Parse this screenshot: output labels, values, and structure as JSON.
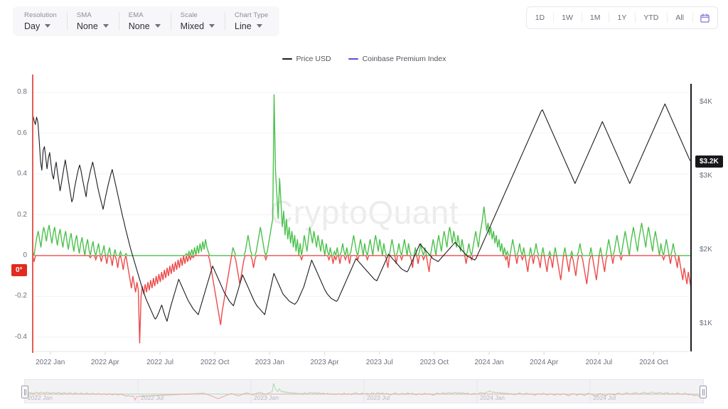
{
  "toolbar": {
    "groups": [
      {
        "label": "Resolution",
        "value": "Day",
        "name": "resolution"
      },
      {
        "label": "SMA",
        "value": "None",
        "name": "sma"
      },
      {
        "label": "EMA",
        "value": "None",
        "name": "ema"
      },
      {
        "label": "Scale",
        "value": "Mixed",
        "name": "scale"
      },
      {
        "label": "Chart Type",
        "value": "Line",
        "name": "chart-type"
      }
    ]
  },
  "range_bar": {
    "buttons": [
      "1D",
      "1W",
      "1M",
      "1Y",
      "YTD",
      "All"
    ],
    "calendar_icon": "calendar-icon",
    "accent": "#7b61d9"
  },
  "watermark": "CryptoQuant",
  "badges": {
    "price": "$3.2K",
    "zero": "0°"
  },
  "chart_data": {
    "type": "line",
    "title": "",
    "xlabel": "",
    "legend": [
      {
        "label": "Price USD",
        "color": "#1d1d22"
      },
      {
        "label": "Coinbase Premium Index",
        "color": "#5b4fd6"
      }
    ],
    "legend_position": "top-center",
    "grid": true,
    "x_ticks": [
      "2022 Jan",
      "2022 Apr",
      "2022 Jul",
      "2022 Oct",
      "2023 Jan",
      "2023 Apr",
      "2023 Jul",
      "2023 Oct",
      "2024 Jan",
      "2024 Apr",
      "2024 Jul",
      "2024 Oct"
    ],
    "left_axis": {
      "name": "Coinbase Premium Index",
      "ticks": [
        0.8,
        0.6,
        0.4,
        0.2,
        0,
        -0.2,
        -0.4
      ],
      "tick_labels": [
        "0.8",
        "0.6",
        "0.4",
        "0.2",
        "0",
        "-0.2",
        "-0.4"
      ],
      "ylim": [
        -0.47,
        0.87
      ],
      "zero_line": 0,
      "positive_color": "#4cc14c",
      "negative_color": "#ec4a4a"
    },
    "right_axis": {
      "name": "Price USD",
      "ticks": [
        4000,
        3000,
        2000,
        1000
      ],
      "tick_labels": [
        "$4K",
        "$3K",
        "$2K",
        "$1K"
      ],
      "ylim": [
        620,
        4330
      ],
      "color": "#1d1d22"
    },
    "series": [
      {
        "name": "Price USD",
        "axis": "right",
        "color": "#1d1d22",
        "values": [
          3840,
          3760,
          3700,
          3800,
          3730,
          3480,
          3200,
          3080,
          3350,
          3400,
          3250,
          3100,
          3240,
          3320,
          3170,
          3020,
          2960,
          3100,
          3190,
          3050,
          2930,
          2800,
          2900,
          3010,
          3120,
          3220,
          3100,
          2990,
          2870,
          2760,
          2650,
          2700,
          2830,
          2920,
          3010,
          3090,
          3150,
          3080,
          2980,
          2890,
          2800,
          2720,
          2880,
          2960,
          3050,
          3120,
          3190,
          3110,
          3020,
          2930,
          2840,
          2760,
          2690,
          2620,
          2550,
          2640,
          2730,
          2810,
          2890,
          2960,
          3030,
          3090,
          3010,
          2930,
          2850,
          2770,
          2690,
          2610,
          2530,
          2450,
          2380,
          2300,
          2230,
          2160,
          2090,
          2020,
          1960,
          1900,
          1840,
          1780,
          1720,
          1660,
          1600,
          1540,
          1480,
          1430,
          1380,
          1330,
          1290,
          1250,
          1210,
          1170,
          1130,
          1090,
          1060,
          1080,
          1120,
          1160,
          1210,
          1250,
          1190,
          1130,
          1080,
          1030,
          1100,
          1170,
          1240,
          1300,
          1360,
          1420,
          1480,
          1540,
          1600,
          1560,
          1520,
          1480,
          1440,
          1400,
          1360,
          1320,
          1290,
          1260,
          1230,
          1200,
          1180,
          1160,
          1140,
          1120,
          1180,
          1240,
          1300,
          1360,
          1420,
          1480,
          1540,
          1600,
          1660,
          1720,
          1780,
          1740,
          1700,
          1660,
          1620,
          1580,
          1540,
          1500,
          1460,
          1420,
          1390,
          1360,
          1330,
          1300,
          1280,
          1260,
          1240,
          1300,
          1360,
          1420,
          1480,
          1540,
          1600,
          1660,
          1620,
          1580,
          1540,
          1500,
          1460,
          1420,
          1380,
          1340,
          1300,
          1270,
          1240,
          1220,
          1200,
          1180,
          1160,
          1140,
          1120,
          1200,
          1280,
          1360,
          1440,
          1520,
          1600,
          1680,
          1640,
          1600,
          1560,
          1520,
          1480,
          1440,
          1400,
          1380,
          1360,
          1340,
          1320,
          1300,
          1290,
          1280,
          1270,
          1260,
          1280,
          1300,
          1340,
          1380,
          1420,
          1460,
          1500,
          1560,
          1620,
          1680,
          1740,
          1800,
          1860,
          1820,
          1780,
          1740,
          1700,
          1660,
          1620,
          1580,
          1540,
          1500,
          1460,
          1430,
          1400,
          1380,
          1360,
          1340,
          1330,
          1320,
          1310,
          1300,
          1320,
          1360,
          1400,
          1440,
          1480,
          1520,
          1560,
          1600,
          1640,
          1680,
          1720,
          1760,
          1800,
          1840,
          1880,
          1860,
          1840,
          1820,
          1800,
          1780,
          1760,
          1740,
          1720,
          1700,
          1680,
          1660,
          1640,
          1620,
          1600,
          1590,
          1580,
          1620,
          1660,
          1700,
          1740,
          1780,
          1820,
          1860,
          1900,
          1940,
          1920,
          1900,
          1880,
          1860,
          1840,
          1820,
          1800,
          1780,
          1760,
          1740,
          1730,
          1720,
          1710,
          1700,
          1720,
          1760,
          1800,
          1840,
          1880,
          1920,
          1960,
          2000,
          2040,
          2080,
          2060,
          2040,
          2020,
          2000,
          1980,
          1960,
          1940,
          1920,
          1900,
          1880,
          1870,
          1860,
          1850,
          1840,
          1860,
          1880,
          1900,
          1920,
          1940,
          1960,
          1980,
          2000,
          2020,
          2040,
          2060,
          2080,
          2100,
          2080,
          2060,
          2040,
          2020,
          2000,
          1980,
          1960,
          1940,
          1920,
          1910,
          1900,
          1890,
          1880,
          1870,
          1860,
          1880,
          1920,
          1960,
          2000,
          2040,
          2080,
          2120,
          2160,
          2200,
          2240,
          2280,
          2320,
          2360,
          2400,
          2440,
          2480,
          2520,
          2560,
          2600,
          2640,
          2680,
          2720,
          2760,
          2800,
          2840,
          2880,
          2920,
          2960,
          3000,
          3040,
          3080,
          3120,
          3160,
          3200,
          3240,
          3280,
          3320,
          3360,
          3400,
          3440,
          3480,
          3520,
          3560,
          3600,
          3640,
          3680,
          3720,
          3760,
          3800,
          3840,
          3880,
          3900,
          3860,
          3820,
          3780,
          3740,
          3700,
          3660,
          3620,
          3580,
          3540,
          3500,
          3460,
          3420,
          3380,
          3340,
          3300,
          3260,
          3220,
          3180,
          3140,
          3100,
          3060,
          3020,
          2980,
          2940,
          2900,
          2940,
          2980,
          3020,
          3060,
          3100,
          3140,
          3180,
          3220,
          3260,
          3300,
          3340,
          3380,
          3420,
          3460,
          3500,
          3540,
          3580,
          3620,
          3660,
          3700,
          3740,
          3700,
          3660,
          3620,
          3580,
          3540,
          3500,
          3460,
          3420,
          3380,
          3340,
          3300,
          3260,
          3220,
          3180,
          3140,
          3100,
          3060,
          3020,
          2980,
          2940,
          2900,
          2940,
          2980,
          3020,
          3060,
          3100,
          3140,
          3180,
          3220,
          3260,
          3300,
          3340,
          3380,
          3420,
          3460,
          3500,
          3540,
          3580,
          3620,
          3660,
          3700,
          3740,
          3780,
          3820,
          3860,
          3900,
          3940,
          3980,
          3940,
          3900,
          3860,
          3820,
          3780,
          3740,
          3700,
          3660,
          3620,
          3580,
          3540,
          3500,
          3460,
          3420,
          3380,
          3340,
          3300,
          3260,
          3220,
          3200
        ],
        "last_value": 3200
      },
      {
        "name": "Coinbase Premium Index",
        "axis": "left",
        "color_positive": "#4cc14c",
        "color_negative": "#ec4a4a",
        "values": [
          0.02,
          -0.03,
          0.05,
          0.09,
          0.12,
          0.08,
          0.04,
          0.1,
          0.14,
          0.11,
          0.07,
          0.12,
          0.15,
          0.1,
          0.06,
          0.11,
          0.14,
          0.09,
          0.05,
          0.1,
          0.13,
          0.08,
          0.04,
          0.09,
          0.12,
          0.07,
          0.03,
          0.08,
          0.11,
          0.06,
          0.02,
          0.07,
          0.1,
          0.05,
          0.01,
          0.06,
          0.09,
          0.04,
          0.0,
          0.05,
          0.08,
          0.03,
          -0.01,
          0.04,
          0.07,
          0.02,
          -0.02,
          0.03,
          0.06,
          0.01,
          -0.03,
          0.02,
          0.05,
          0.0,
          -0.04,
          0.01,
          0.04,
          -0.01,
          -0.05,
          0.0,
          0.03,
          -0.02,
          -0.06,
          -0.01,
          0.02,
          -0.03,
          -0.07,
          -0.02,
          0.01,
          -0.04,
          -0.08,
          -0.12,
          -0.16,
          -0.1,
          -0.14,
          -0.18,
          -0.13,
          -0.17,
          -0.43,
          -0.2,
          -0.15,
          -0.19,
          -0.14,
          -0.18,
          -0.13,
          -0.17,
          -0.12,
          -0.16,
          -0.11,
          -0.15,
          -0.1,
          -0.14,
          -0.09,
          -0.13,
          -0.08,
          -0.12,
          -0.07,
          -0.11,
          -0.06,
          -0.1,
          -0.05,
          -0.09,
          -0.04,
          -0.08,
          -0.03,
          -0.07,
          -0.02,
          -0.06,
          -0.01,
          -0.05,
          0.0,
          -0.04,
          0.01,
          -0.03,
          0.02,
          -0.02,
          0.03,
          -0.01,
          0.04,
          0.0,
          0.05,
          0.01,
          0.06,
          0.02,
          0.07,
          0.03,
          0.08,
          0.04,
          0.02,
          -0.02,
          -0.06,
          -0.1,
          -0.14,
          -0.18,
          -0.22,
          -0.26,
          -0.3,
          -0.34,
          -0.28,
          -0.24,
          -0.2,
          -0.16,
          -0.12,
          -0.08,
          -0.04,
          0.0,
          0.04,
          0.02,
          -0.02,
          -0.06,
          -0.1,
          -0.14,
          -0.1,
          -0.06,
          -0.02,
          0.02,
          0.06,
          0.1,
          0.06,
          0.02,
          -0.02,
          -0.06,
          -0.02,
          0.02,
          0.06,
          0.1,
          0.14,
          0.1,
          0.06,
          0.02,
          -0.02,
          0.02,
          0.06,
          0.1,
          0.14,
          0.18,
          0.79,
          0.42,
          0.3,
          0.18,
          0.38,
          0.26,
          0.14,
          0.22,
          0.1,
          0.18,
          0.08,
          0.14,
          0.06,
          0.12,
          0.04,
          0.1,
          0.02,
          0.08,
          0.0,
          0.06,
          -0.02,
          0.04,
          0.1,
          0.06,
          0.02,
          0.08,
          0.14,
          0.1,
          0.06,
          0.12,
          0.08,
          0.04,
          0.1,
          0.06,
          0.02,
          0.08,
          0.04,
          0.0,
          0.06,
          0.02,
          -0.02,
          0.04,
          0.0,
          -0.04,
          0.02,
          -0.02,
          0.04,
          0.0,
          -0.04,
          0.02,
          0.06,
          0.02,
          -0.02,
          0.04,
          0.0,
          -0.04,
          0.02,
          0.06,
          0.1,
          0.06,
          0.02,
          -0.02,
          0.04,
          0.08,
          0.04,
          0.0,
          0.06,
          0.02,
          -0.02,
          0.04,
          0.08,
          0.04,
          0.0,
          0.06,
          0.1,
          0.06,
          0.02,
          0.08,
          0.04,
          0.0,
          0.06,
          0.02,
          -0.02,
          -0.06,
          0.0,
          0.04,
          0.08,
          0.04,
          0.0,
          -0.04,
          0.02,
          0.06,
          0.02,
          -0.02,
          0.04,
          0.08,
          0.04,
          0.0,
          0.06,
          0.02,
          -0.02,
          -0.06,
          0.0,
          0.04,
          0.0,
          -0.04,
          0.02,
          0.06,
          0.02,
          -0.02,
          0.04,
          0.0,
          -0.04,
          -0.08,
          -0.02,
          0.04,
          0.08,
          0.04,
          0.0,
          0.06,
          0.1,
          0.06,
          0.02,
          0.08,
          0.12,
          0.08,
          0.04,
          0.1,
          0.14,
          0.1,
          0.06,
          0.12,
          0.08,
          0.04,
          0.1,
          0.06,
          0.02,
          0.08,
          0.04,
          0.0,
          -0.04,
          0.02,
          0.06,
          0.02,
          -0.02,
          0.04,
          0.08,
          0.12,
          0.08,
          0.04,
          0.1,
          0.14,
          0.18,
          0.24,
          0.18,
          0.12,
          0.16,
          0.1,
          0.14,
          0.08,
          0.12,
          0.06,
          0.1,
          0.04,
          0.08,
          0.02,
          0.06,
          0.0,
          0.04,
          -0.02,
          0.02,
          -0.06,
          0.0,
          0.04,
          0.08,
          0.04,
          0.0,
          -0.04,
          0.02,
          0.06,
          0.02,
          -0.02,
          0.04,
          0.0,
          -0.04,
          -0.08,
          -0.02,
          0.04,
          0.0,
          -0.04,
          0.02,
          0.06,
          0.02,
          -0.02,
          -0.06,
          0.0,
          0.04,
          0.0,
          -0.04,
          -0.08,
          -0.02,
          0.02,
          -0.02,
          -0.06,
          0.0,
          0.04,
          0.0,
          -0.04,
          -0.08,
          -0.12,
          -0.06,
          0.0,
          0.04,
          0.0,
          -0.04,
          -0.08,
          -0.02,
          0.02,
          -0.02,
          -0.06,
          -0.1,
          -0.04,
          0.02,
          0.06,
          0.02,
          -0.02,
          -0.06,
          -0.1,
          -0.14,
          -0.08,
          -0.02,
          0.04,
          0.0,
          -0.04,
          -0.08,
          -0.12,
          -0.06,
          0.0,
          0.04,
          0.0,
          -0.04,
          -0.08,
          -0.02,
          0.04,
          0.08,
          0.04,
          0.0,
          -0.04,
          0.02,
          0.06,
          0.1,
          0.06,
          0.02,
          -0.02,
          0.04,
          0.08,
          0.12,
          0.08,
          0.04,
          0.0,
          0.06,
          0.1,
          0.14,
          0.1,
          0.06,
          0.02,
          0.08,
          0.12,
          0.16,
          0.12,
          0.08,
          0.04,
          0.1,
          0.14,
          0.1,
          0.06,
          0.02,
          0.08,
          0.12,
          0.08,
          0.04,
          0.0,
          0.06,
          0.02,
          -0.02,
          0.04,
          0.08,
          0.04,
          0.0,
          -0.04,
          0.02,
          0.06,
          0.02,
          -0.02,
          -0.06,
          0.0,
          -0.04,
          -0.08,
          -0.12,
          -0.06,
          -0.1,
          -0.14,
          -0.08,
          -0.12,
          -0.16
        ]
      }
    ],
    "crosshair": {
      "x_index": 0,
      "color": "#e85a55"
    }
  },
  "navigator": {
    "x_ticks": [
      "2022 Jan",
      "2022 Jul",
      "2023 Jan",
      "2023 Jul",
      "2024 Jan",
      "2024 Jul"
    ],
    "left_handle": "navigator-left-handle",
    "right_handle": "navigator-right-handle"
  }
}
